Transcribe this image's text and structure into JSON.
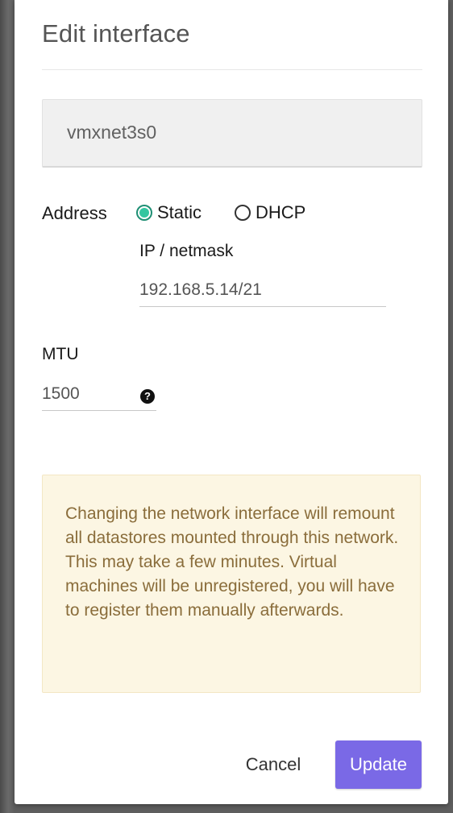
{
  "dialog": {
    "title": "Edit interface",
    "interface_name": "vmxnet3s0"
  },
  "address": {
    "label": "Address",
    "options": [
      {
        "label": "Static",
        "selected": true
      },
      {
        "label": "DHCP",
        "selected": false
      }
    ],
    "ip_label": "IP / netmask",
    "ip_value": "192.168.5.14/21"
  },
  "mtu": {
    "label": "MTU",
    "value": "1500",
    "help_icon": "question-circle-icon",
    "help_glyph": "?"
  },
  "warning": {
    "text": "Changing the network interface will remount all datastores mounted through this network. This may take a few minutes. Virtual machines will be unregistered, you will have to register them manually afterwards."
  },
  "actions": {
    "cancel_label": "Cancel",
    "update_label": "Update"
  },
  "colors": {
    "accent": "#7a69e6",
    "radio_selected": "#33c6a0",
    "warning_bg": "#fcf6e3",
    "warning_text": "#8a6d3b"
  }
}
